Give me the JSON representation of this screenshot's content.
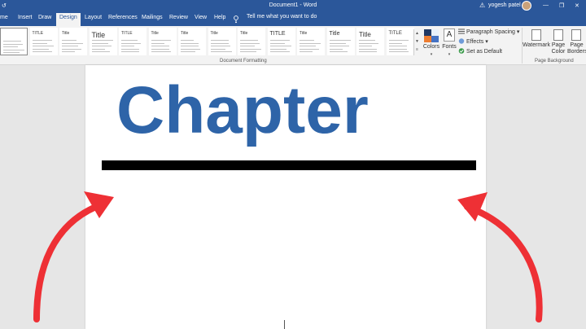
{
  "titlebar": {
    "document_title": "Document1 - Word",
    "user_name": "yogesh patel",
    "warning_icon": "warning-icon",
    "undo_glyph": "↺",
    "minimize_glyph": "—",
    "restore_glyph": "❐",
    "close_glyph": "✕"
  },
  "tabs": [
    "me",
    "Insert",
    "Draw",
    "Design",
    "Layout",
    "References",
    "Mailings",
    "Review",
    "View",
    "Help"
  ],
  "active_tab": "Design",
  "tell_me": "Tell me what you want to do",
  "ribbon": {
    "style_gallery": [
      {
        "title": "",
        "size": 8
      },
      {
        "title": "TITLE",
        "size": 5
      },
      {
        "title": "Title",
        "size": 5
      },
      {
        "title": "Title",
        "size": 9
      },
      {
        "title": "TITLE",
        "size": 5
      },
      {
        "title": "Title",
        "size": 5
      },
      {
        "title": "Title",
        "size": 5
      },
      {
        "title": "Title",
        "size": 5
      },
      {
        "title": "Title",
        "size": 5
      },
      {
        "title": "TITLE",
        "size": 7
      },
      {
        "title": "Title",
        "size": 5
      },
      {
        "title": "Title",
        "size": 7
      },
      {
        "title": "Title",
        "size": 8
      },
      {
        "title": "TITLE",
        "size": 6
      }
    ],
    "document_formatting_label": "Document Formatting",
    "colors_label": "Colors",
    "fonts_label": "Fonts",
    "paragraph_spacing_label": "Paragraph Spacing",
    "effects_label": "Effects",
    "set_default_label": "Set as Default",
    "watermark_label": "Watermark",
    "page_color_label": "Page Color",
    "page_borders_label": "Page Borders",
    "page_background_label": "Page Background",
    "theme_colors": [
      "#1f3864",
      "#e8f0fa",
      "#ed7d31",
      "#4472c4"
    ]
  },
  "document": {
    "heading_text": "Chapter",
    "heading_color": "#2e64a8",
    "rule_color": "#000000"
  },
  "annotation": {
    "arrow_color": "#ee3035"
  }
}
